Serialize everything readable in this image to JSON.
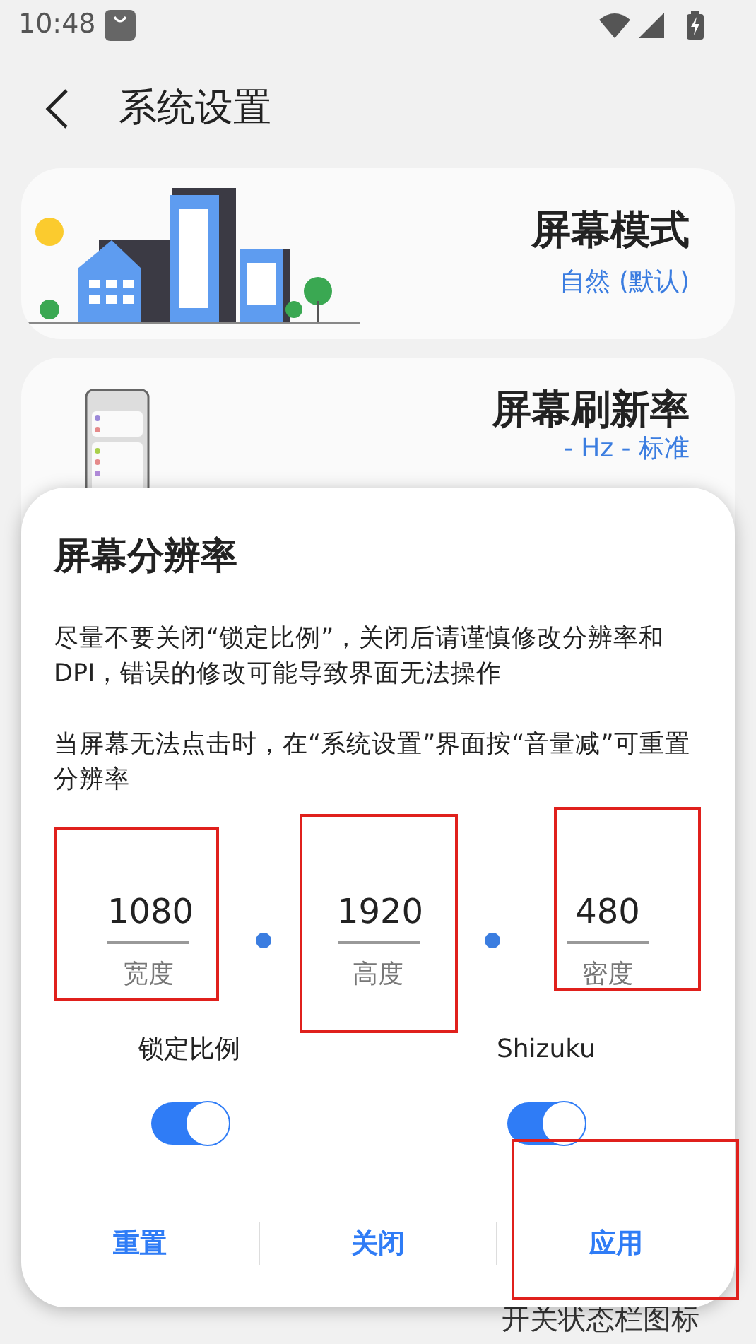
{
  "status_bar": {
    "time": "10:48"
  },
  "header": {
    "title": "系统设置"
  },
  "cards": [
    {
      "kind": "city",
      "title": "屏幕模式",
      "subtitle": "自然 (默认)"
    },
    {
      "kind": "phone",
      "title": "屏幕刷新率",
      "subtitle": "- Hz - 标准"
    }
  ],
  "behind_text": "开关状态栏图标",
  "dialog": {
    "title": "屏幕分辨率",
    "paragraphs": [
      "尽量不要关闭“锁定比例”，关闭后请谨慎修改分辨率和DPI，错误的修改可能导致界面无法操作",
      "当屏幕无法点击时，在“系统设置”界面按“音量减”可重置分辨率"
    ],
    "fields": [
      {
        "value": "1080",
        "label": "宽度"
      },
      {
        "value": "1920",
        "label": "高度"
      },
      {
        "value": "480",
        "label": "密度"
      }
    ],
    "switches": [
      {
        "label": "锁定比例",
        "on": true
      },
      {
        "label": "Shizuku",
        "on": true
      }
    ],
    "buttons": [
      "重置",
      "关闭",
      "应用"
    ]
  }
}
